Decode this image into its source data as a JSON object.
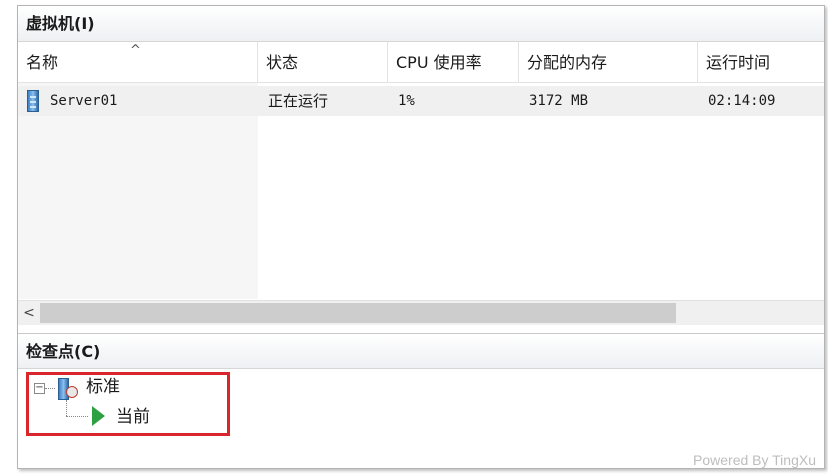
{
  "vm_panel": {
    "title": "虚拟机(I)",
    "columns": [
      "名称",
      "状态",
      "CPU 使用率",
      "分配的内存",
      "运行时间"
    ],
    "sort_indicator": "^",
    "rows": [
      {
        "name": "Server01",
        "state": "正在运行",
        "cpu": "1%",
        "memory": "3172 MB",
        "uptime": "02:14:09"
      }
    ],
    "scroll_left_glyph": "<"
  },
  "checkpoint_panel": {
    "title": "检查点(C)",
    "expander_glyph": "−",
    "tree": {
      "root_label": "标准",
      "child_label": "当前"
    },
    "highlight_color": "#d9262c"
  },
  "watermark": "Powered By TingXu",
  "icons": {
    "server": "server-icon",
    "checkpoint": "checkpoint-icon",
    "current": "play-icon"
  }
}
